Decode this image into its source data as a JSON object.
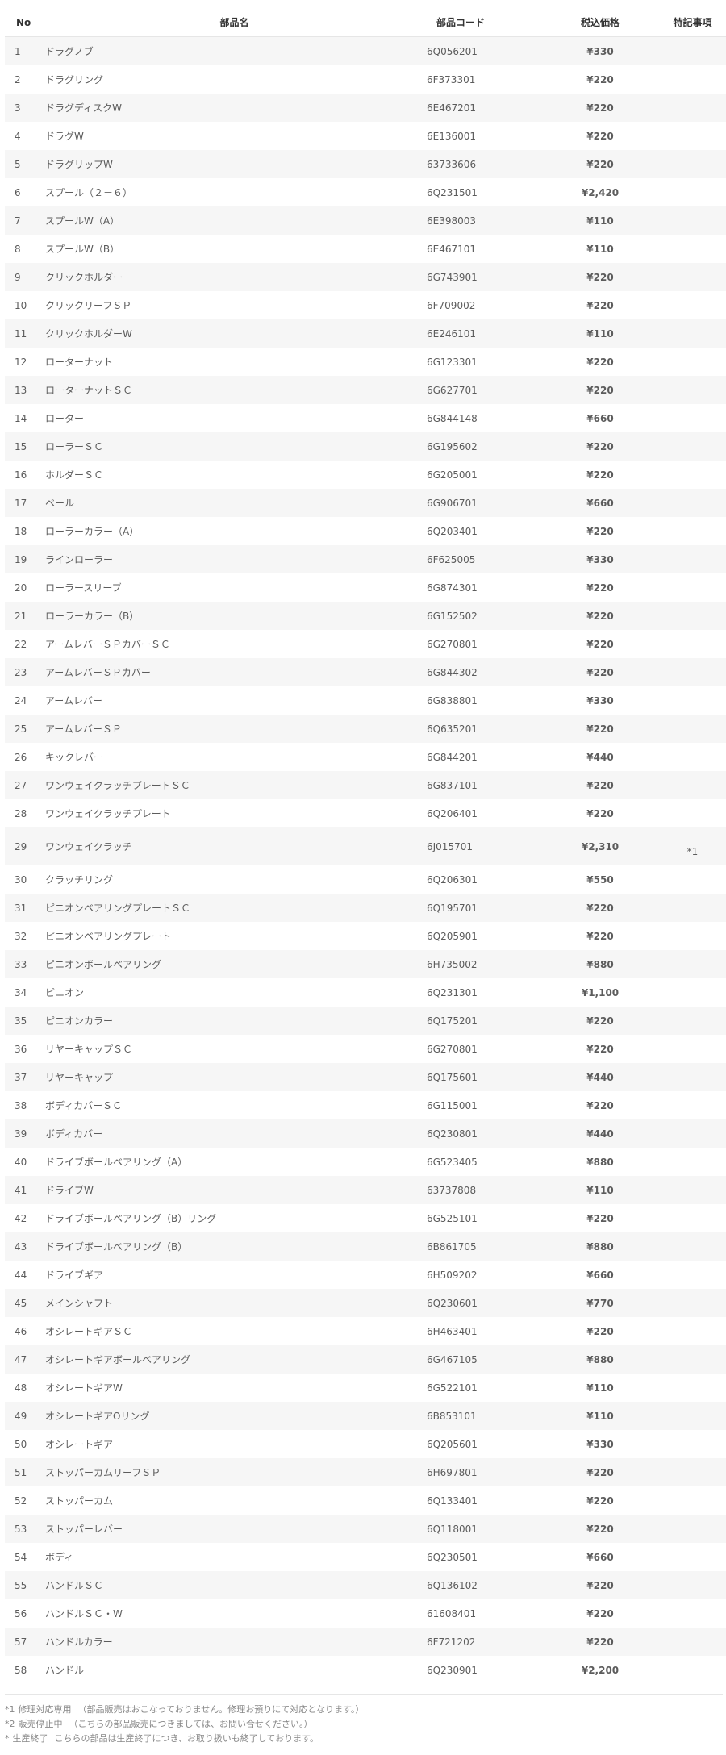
{
  "table": {
    "headers": {
      "no": "No",
      "name": "部品名",
      "code": "部品コード",
      "price": "税込価格",
      "note": "特記事項"
    },
    "rows": [
      {
        "no": "1",
        "name": "ドラグノブ",
        "code": "6Q056201",
        "price": "¥330",
        "note": ""
      },
      {
        "no": "2",
        "name": "ドラグリング",
        "code": "6F373301",
        "price": "¥220",
        "note": ""
      },
      {
        "no": "3",
        "name": "ドラグディスクW",
        "code": "6E467201",
        "price": "¥220",
        "note": ""
      },
      {
        "no": "4",
        "name": "ドラグW",
        "code": "6E136001",
        "price": "¥220",
        "note": ""
      },
      {
        "no": "5",
        "name": "ドラグリップW",
        "code": "63733606",
        "price": "¥220",
        "note": ""
      },
      {
        "no": "6",
        "name": "スプール（２－６）",
        "code": "6Q231501",
        "price": "¥2,420",
        "note": ""
      },
      {
        "no": "7",
        "name": "スプールW（A）",
        "code": "6E398003",
        "price": "¥110",
        "note": ""
      },
      {
        "no": "8",
        "name": "スプールW（B）",
        "code": "6E467101",
        "price": "¥110",
        "note": ""
      },
      {
        "no": "9",
        "name": "クリックホルダー",
        "code": "6G743901",
        "price": "¥220",
        "note": ""
      },
      {
        "no": "10",
        "name": "クリックリーフＳＰ",
        "code": "6F709002",
        "price": "¥220",
        "note": ""
      },
      {
        "no": "11",
        "name": "クリックホルダーW",
        "code": "6E246101",
        "price": "¥110",
        "note": ""
      },
      {
        "no": "12",
        "name": "ローターナット",
        "code": "6G123301",
        "price": "¥220",
        "note": ""
      },
      {
        "no": "13",
        "name": "ローターナットＳＣ",
        "code": "6G627701",
        "price": "¥220",
        "note": ""
      },
      {
        "no": "14",
        "name": "ローター",
        "code": "6G844148",
        "price": "¥660",
        "note": ""
      },
      {
        "no": "15",
        "name": "ローラーＳＣ",
        "code": "6G195602",
        "price": "¥220",
        "note": ""
      },
      {
        "no": "16",
        "name": "ホルダーＳＣ",
        "code": "6G205001",
        "price": "¥220",
        "note": ""
      },
      {
        "no": "17",
        "name": "ベール",
        "code": "6G906701",
        "price": "¥660",
        "note": ""
      },
      {
        "no": "18",
        "name": "ローラーカラー（A）",
        "code": "6Q203401",
        "price": "¥220",
        "note": ""
      },
      {
        "no": "19",
        "name": "ラインローラー",
        "code": "6F625005",
        "price": "¥330",
        "note": ""
      },
      {
        "no": "20",
        "name": "ローラースリーブ",
        "code": "6G874301",
        "price": "¥220",
        "note": ""
      },
      {
        "no": "21",
        "name": "ローラーカラー（B）",
        "code": "6G152502",
        "price": "¥220",
        "note": ""
      },
      {
        "no": "22",
        "name": "アームレバーＳＰカバーＳＣ",
        "code": "6G270801",
        "price": "¥220",
        "note": ""
      },
      {
        "no": "23",
        "name": "アームレバーＳＰカバー",
        "code": "6G844302",
        "price": "¥220",
        "note": ""
      },
      {
        "no": "24",
        "name": "アームレバー",
        "code": "6G838801",
        "price": "¥330",
        "note": ""
      },
      {
        "no": "25",
        "name": "アームレバーＳＰ",
        "code": "6Q635201",
        "price": "¥220",
        "note": ""
      },
      {
        "no": "26",
        "name": "キックレバー",
        "code": "6G844201",
        "price": "¥440",
        "note": ""
      },
      {
        "no": "27",
        "name": "ワンウェイクラッチプレートＳＣ",
        "code": "6G837101",
        "price": "¥220",
        "note": ""
      },
      {
        "no": "28",
        "name": "ワンウェイクラッチプレート",
        "code": "6Q206401",
        "price": "¥220",
        "note": ""
      },
      {
        "no": "29",
        "name": "ワンウェイクラッチ",
        "code": "6J015701",
        "price": "¥2,310",
        "note": "*1"
      },
      {
        "no": "30",
        "name": "クラッチリング",
        "code": "6Q206301",
        "price": "¥550",
        "note": ""
      },
      {
        "no": "31",
        "name": "ピニオンベアリングプレートＳＣ",
        "code": "6Q195701",
        "price": "¥220",
        "note": ""
      },
      {
        "no": "32",
        "name": "ピニオンベアリングプレート",
        "code": "6Q205901",
        "price": "¥220",
        "note": ""
      },
      {
        "no": "33",
        "name": "ピニオンボールベアリング",
        "code": "6H735002",
        "price": "¥880",
        "note": ""
      },
      {
        "no": "34",
        "name": "ピニオン",
        "code": "6Q231301",
        "price": "¥1,100",
        "note": ""
      },
      {
        "no": "35",
        "name": "ピニオンカラー",
        "code": "6Q175201",
        "price": "¥220",
        "note": ""
      },
      {
        "no": "36",
        "name": "リヤーキャップＳＣ",
        "code": "6G270801",
        "price": "¥220",
        "note": ""
      },
      {
        "no": "37",
        "name": "リヤーキャップ",
        "code": "6Q175601",
        "price": "¥440",
        "note": ""
      },
      {
        "no": "38",
        "name": "ボディカバーＳＣ",
        "code": "6G115001",
        "price": "¥220",
        "note": ""
      },
      {
        "no": "39",
        "name": "ボディカバー",
        "code": "6Q230801",
        "price": "¥440",
        "note": ""
      },
      {
        "no": "40",
        "name": "ドライブボールベアリング（A）",
        "code": "6G523405",
        "price": "¥880",
        "note": ""
      },
      {
        "no": "41",
        "name": "ドライブW",
        "code": "63737808",
        "price": "¥110",
        "note": ""
      },
      {
        "no": "42",
        "name": "ドライブボールベアリング（B）リング",
        "code": "6G525101",
        "price": "¥220",
        "note": ""
      },
      {
        "no": "43",
        "name": "ドライブボールベアリング（B）",
        "code": "6B861705",
        "price": "¥880",
        "note": ""
      },
      {
        "no": "44",
        "name": "ドライブギア",
        "code": "6H509202",
        "price": "¥660",
        "note": ""
      },
      {
        "no": "45",
        "name": "メインシャフト",
        "code": "6Q230601",
        "price": "¥770",
        "note": ""
      },
      {
        "no": "46",
        "name": "オシレートギアＳＣ",
        "code": "6H463401",
        "price": "¥220",
        "note": ""
      },
      {
        "no": "47",
        "name": "オシレートギアボールベアリング",
        "code": "6G467105",
        "price": "¥880",
        "note": ""
      },
      {
        "no": "48",
        "name": "オシレートギアW",
        "code": "6G522101",
        "price": "¥110",
        "note": ""
      },
      {
        "no": "49",
        "name": "オシレートギアOリング",
        "code": "6B853101",
        "price": "¥110",
        "note": ""
      },
      {
        "no": "50",
        "name": "オシレートギア",
        "code": "6Q205601",
        "price": "¥330",
        "note": ""
      },
      {
        "no": "51",
        "name": "ストッパーカムリーフＳＰ",
        "code": "6H697801",
        "price": "¥220",
        "note": ""
      },
      {
        "no": "52",
        "name": "ストッパーカム",
        "code": "6Q133401",
        "price": "¥220",
        "note": ""
      },
      {
        "no": "53",
        "name": "ストッパーレバー",
        "code": "6Q118001",
        "price": "¥220",
        "note": ""
      },
      {
        "no": "54",
        "name": "ボディ",
        "code": "6Q230501",
        "price": "¥660",
        "note": ""
      },
      {
        "no": "55",
        "name": "ハンドルＳＣ",
        "code": "6Q136102",
        "price": "¥220",
        "note": ""
      },
      {
        "no": "56",
        "name": "ハンドルＳＣ・W",
        "code": "61608401",
        "price": "¥220",
        "note": ""
      },
      {
        "no": "57",
        "name": "ハンドルカラー",
        "code": "6F721202",
        "price": "¥220",
        "note": ""
      },
      {
        "no": "58",
        "name": "ハンドル",
        "code": "6Q230901",
        "price": "¥2,200",
        "note": ""
      }
    ]
  },
  "footnotes": [
    {
      "symbol": "*1",
      "label": "修理対応専用",
      "text": "（部品販売はおこなっておりません。修理お預りにて対応となります。）"
    },
    {
      "symbol": "*2",
      "label": "販売停止中",
      "text": "（こちらの部品販売につきましては、お問い合せください。）"
    },
    {
      "symbol": "*",
      "label": "生産終了",
      "text": "こちらの部品は生産終了につき、お取り扱いも終了しております。"
    }
  ]
}
